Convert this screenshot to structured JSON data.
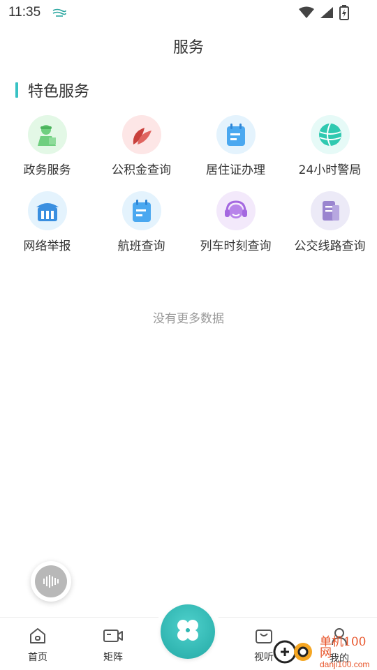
{
  "status_bar": {
    "time": "11:35"
  },
  "page_title": "服务",
  "section": {
    "title": "特色服务"
  },
  "services": [
    {
      "label": "政务服务",
      "icon": "government-worker-icon",
      "bg": "#e3f8e6",
      "color": "#6fcf7f"
    },
    {
      "label": "公积金查询",
      "icon": "leaf-icon",
      "bg": "#fde6e6",
      "color": "#d9534f"
    },
    {
      "label": "居住证办理",
      "icon": "calendar-card-icon",
      "bg": "#e4f3fd",
      "color": "#4aa8f0"
    },
    {
      "label": "24小时警局",
      "icon": "globe-icon",
      "bg": "#e6faf7",
      "color": "#2fc9b0"
    },
    {
      "label": "网络举报",
      "icon": "building-icon",
      "bg": "#e4f3fd",
      "color": "#3a8fe0"
    },
    {
      "label": "航班查询",
      "icon": "calendar-card-icon",
      "bg": "#e4f3fd",
      "color": "#4aa8f0"
    },
    {
      "label": "列车时刻查询",
      "icon": "headset-icon",
      "bg": "#f3e9fb",
      "color": "#a468e0"
    },
    {
      "label": "公交线路查询",
      "icon": "document-icon",
      "bg": "#eceaf7",
      "color": "#9a85cf"
    }
  ],
  "no_more_text": "没有更多数据",
  "bottom_nav": {
    "home": "首页",
    "matrix": "矩阵",
    "media": "视听",
    "mine": "我的"
  },
  "watermark": {
    "main": "单机100网",
    "sub": "danji100.com"
  }
}
